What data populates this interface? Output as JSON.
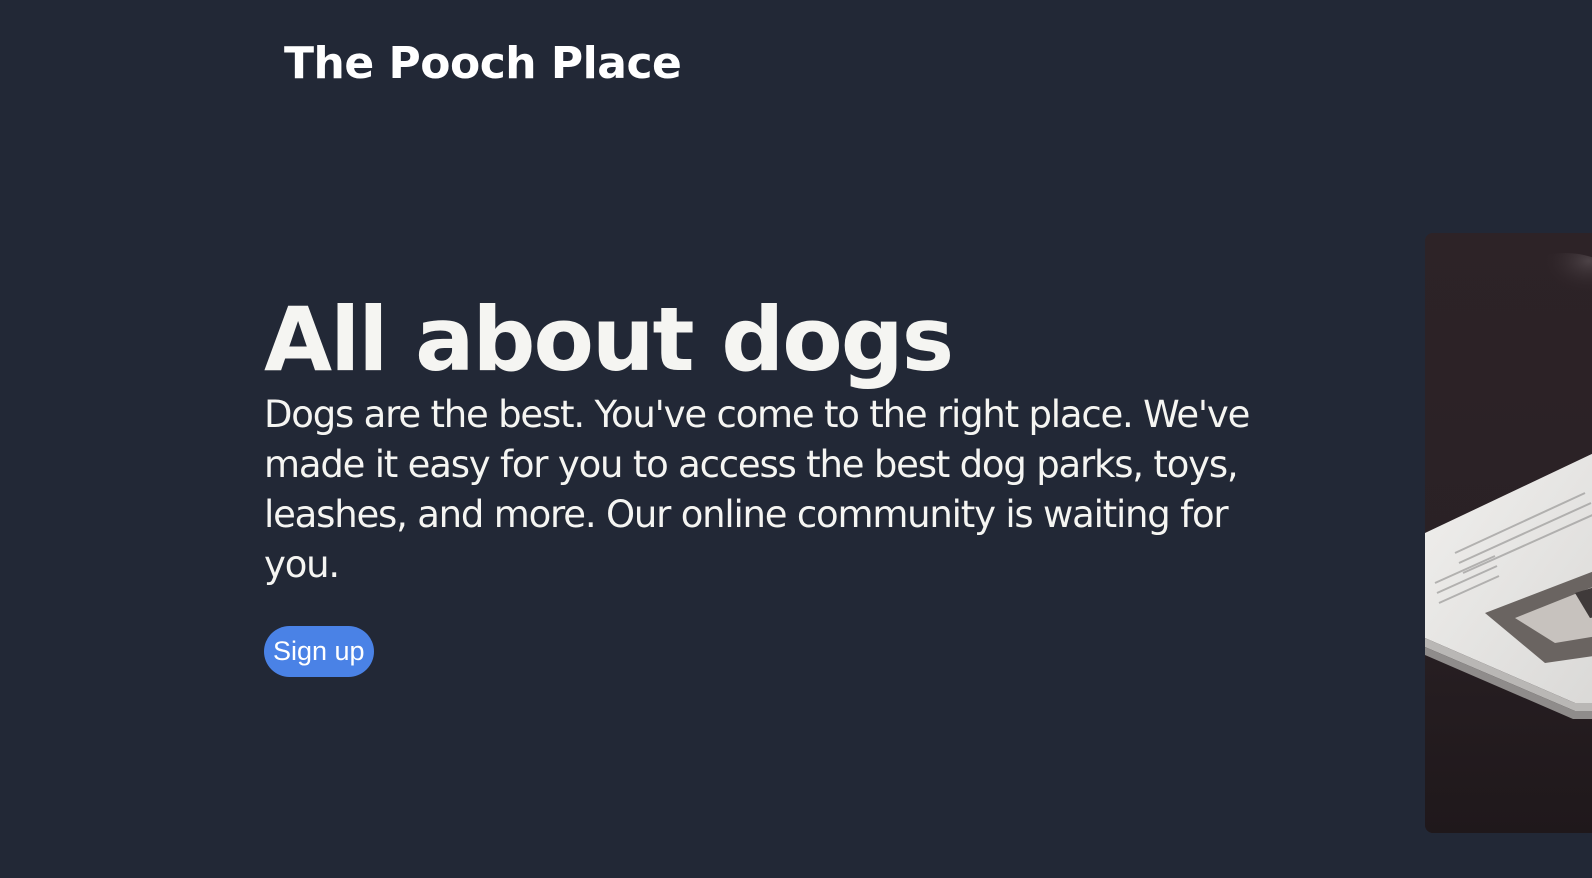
{
  "header": {
    "site_title": "The Pooch Place"
  },
  "hero": {
    "heading": "All about dogs",
    "body": "Dogs are the best. You've come to the right place. We've made it easy for you to access the best dog parks, toys, leashes, and more. Our online community is waiting for you.",
    "signup_label": "Sign up"
  },
  "colors": {
    "background": "#222836",
    "text": "#f5f5f2",
    "button": "#4a82e6"
  }
}
